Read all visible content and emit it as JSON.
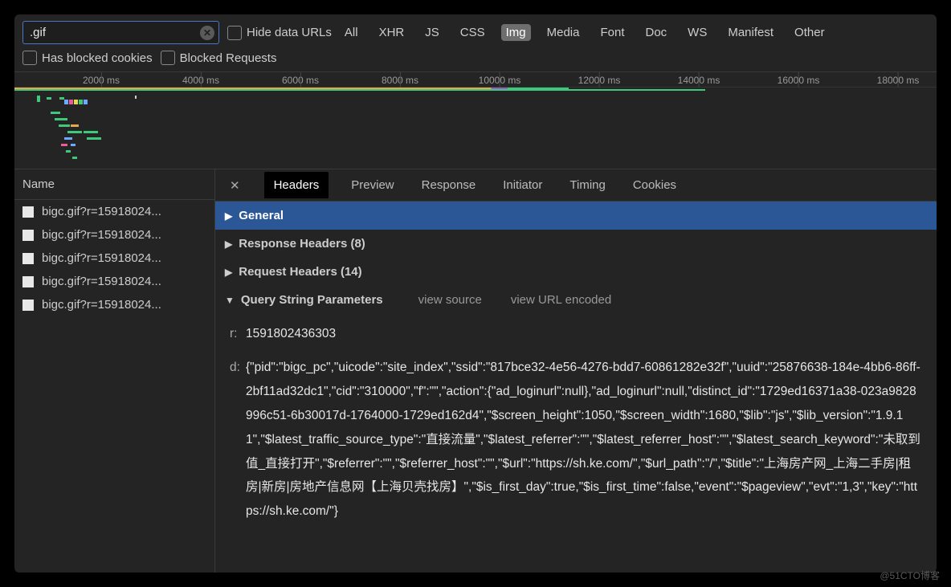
{
  "toolbar": {
    "filter_value": ".gif",
    "hide_data_urls": "Hide data URLs",
    "has_blocked_cookies": "Has blocked cookies",
    "blocked_requests": "Blocked Requests"
  },
  "filter_types": [
    "All",
    "XHR",
    "JS",
    "CSS",
    "Img",
    "Media",
    "Font",
    "Doc",
    "WS",
    "Manifest",
    "Other"
  ],
  "active_filter_type": "Img",
  "ruler_ticks": [
    "2000 ms",
    "4000 ms",
    "6000 ms",
    "8000 ms",
    "10000 ms",
    "12000 ms",
    "14000 ms",
    "16000 ms",
    "18000 ms"
  ],
  "left_header": "Name",
  "requests": [
    "bigc.gif?r=15918024...",
    "bigc.gif?r=15918024...",
    "bigc.gif?r=15918024...",
    "bigc.gif?r=15918024...",
    "bigc.gif?r=15918024..."
  ],
  "tabs": [
    "Headers",
    "Preview",
    "Response",
    "Initiator",
    "Timing",
    "Cookies"
  ],
  "active_tab": "Headers",
  "sections": {
    "general": "General",
    "response_headers": "Response Headers (8)",
    "request_headers": "Request Headers (14)",
    "qsp": "Query String Parameters",
    "view_source": "view source",
    "view_url_encoded": "view URL encoded"
  },
  "query_params": {
    "r_key": "r:",
    "r_val": "1591802436303",
    "d_key": "d:",
    "d_val": "{\"pid\":\"bigc_pc\",\"uicode\":\"site_index\",\"ssid\":\"817bce32-4e56-4276-bdd7-60861282e32f\",\"uuid\":\"25876638-184e-4bb6-86ff-2bf11ad32dc1\",\"cid\":\"310000\",\"f\":\"\",\"action\":{\"ad_loginurl\":null},\"ad_loginurl\":null,\"distinct_id\":\"1729ed16371a38-023a9828996c51-6b30017d-1764000-1729ed162d4\",\"$screen_height\":1050,\"$screen_width\":1680,\"$lib\":\"js\",\"$lib_version\":\"1.9.11\",\"$latest_traffic_source_type\":\"直接流量\",\"$latest_referrer\":\"\",\"$latest_referrer_host\":\"\",\"$latest_search_keyword\":\"未取到值_直接打开\",\"$referrer\":\"\",\"$referrer_host\":\"\",\"$url\":\"https://sh.ke.com/\",\"$url_path\":\"/\",\"$title\":\"上海房产网_上海二手房|租房|新房|房地产信息网【上海贝壳找房】\",\"$is_first_day\":true,\"$is_first_time\":false,\"event\":\"$pageview\",\"evt\":\"1,3\",\"key\":\"https://sh.ke.com/\"}"
  },
  "watermark": "@51CTO博客"
}
